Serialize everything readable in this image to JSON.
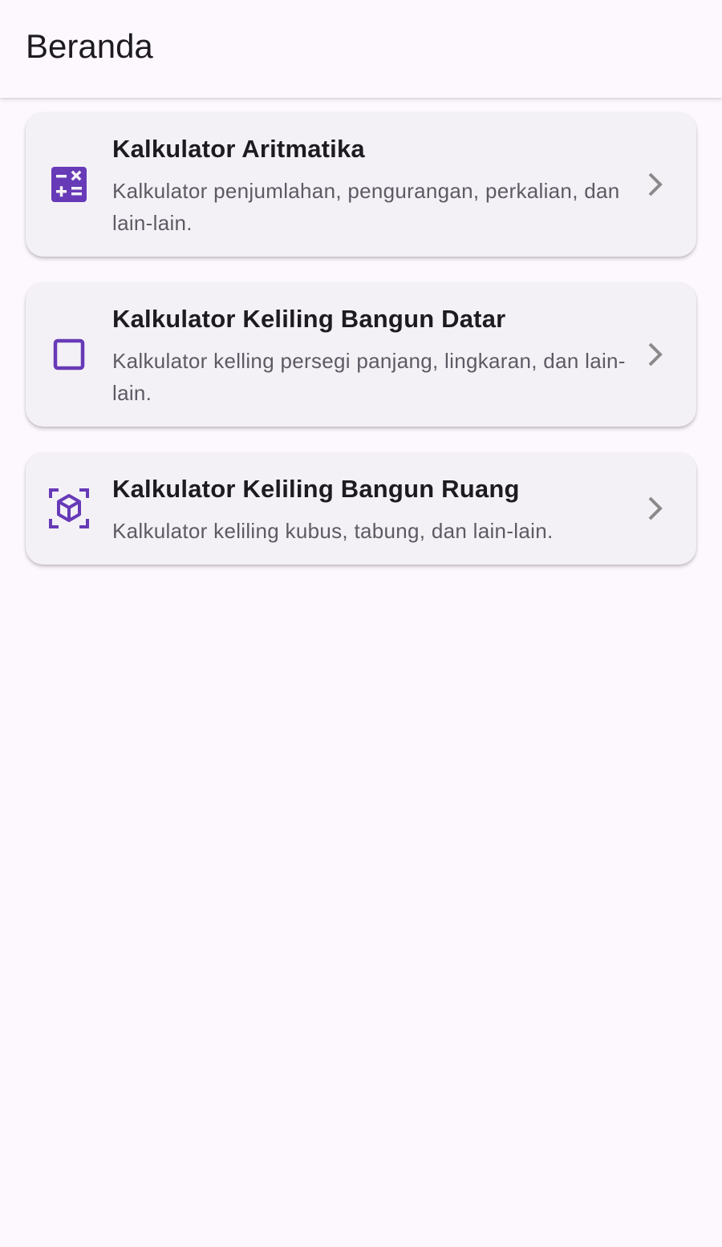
{
  "app_bar": {
    "title": "Beranda"
  },
  "menu": [
    {
      "icon": "calculate-icon",
      "title": "Kalkulator Aritmatika",
      "subtitle": "Kalkulator penjumlahan, pengurangan, perkalian, dan lain-lain."
    },
    {
      "icon": "square-outline-icon",
      "title": "Kalkulator Keliling Bangun Datar",
      "subtitle": "Kalkulator kelling persegi panjang, lingkaran, dan lain-lain."
    },
    {
      "icon": "view-in-ar-icon",
      "title": "Kalkulator Keliling Bangun Ruang",
      "subtitle": "Kalkulator keliling kubus, tabung, dan lain-lain."
    }
  ],
  "colors": {
    "background": "#fdf7fe",
    "card": "#f4f1f6",
    "icon_accent": "#673ab7",
    "chevron": "#8a8a8a",
    "title_text": "#1d1b20",
    "subtitle_text": "#5e5a64"
  }
}
